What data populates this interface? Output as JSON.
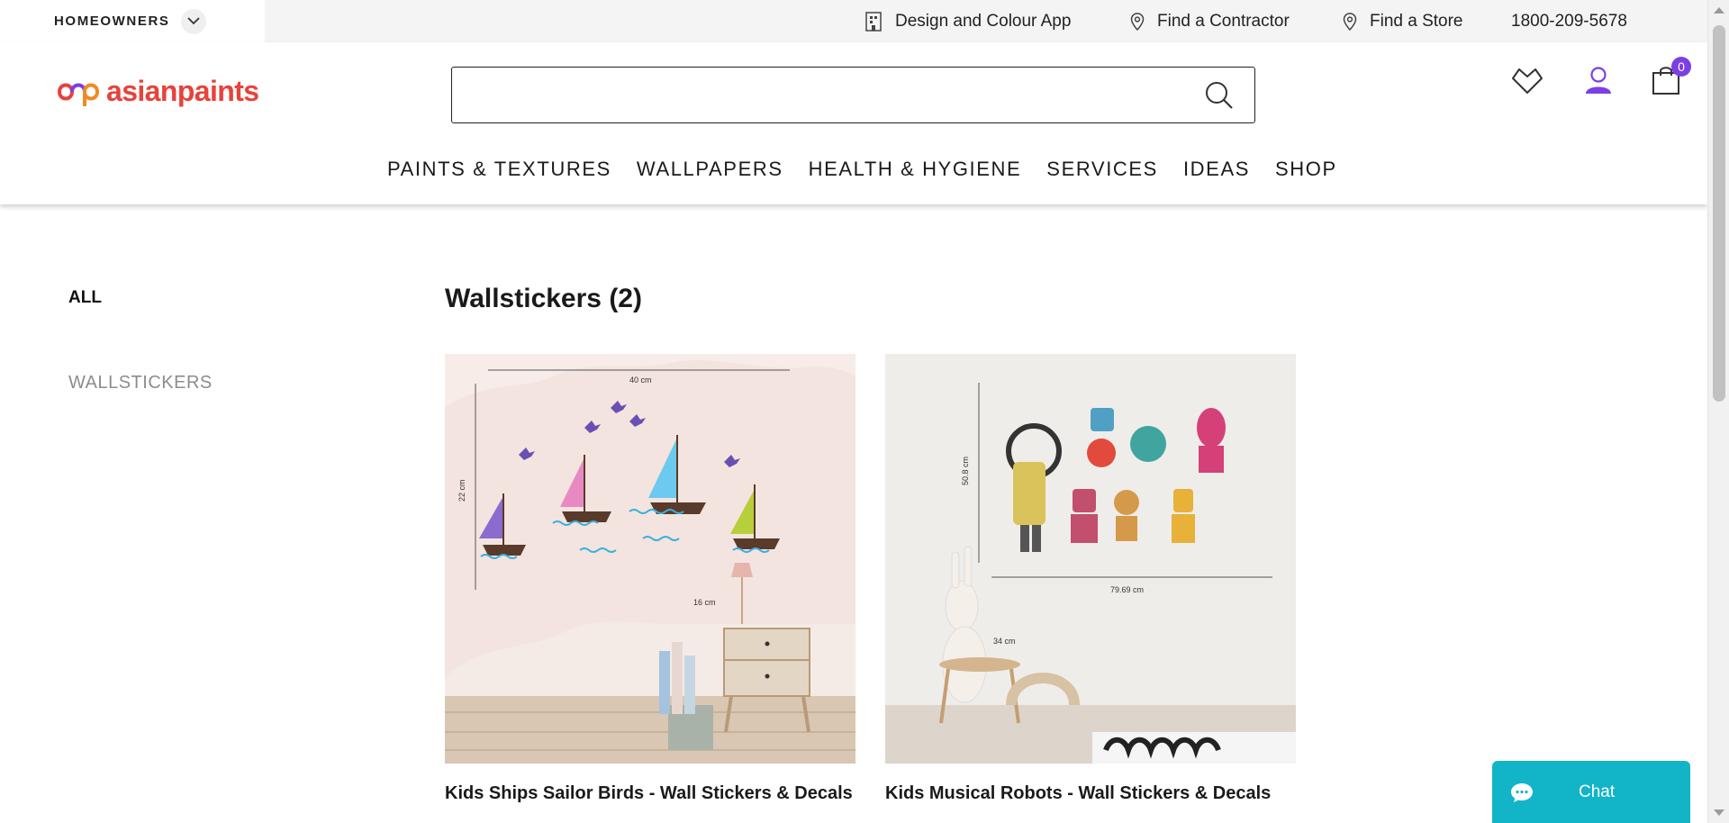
{
  "utility_bar": {
    "audience_label": "HOMEOWNERS",
    "links": [
      {
        "label": "Design and Colour App",
        "icon": "building-icon"
      },
      {
        "label": "Find a Contractor",
        "icon": "location-pin-icon"
      },
      {
        "label": "Find a Store",
        "icon": "location-pin-icon"
      },
      {
        "label": "1800-209-5678"
      }
    ]
  },
  "header": {
    "logo_text": "asianpaints",
    "search": {
      "value": "",
      "placeholder": ""
    },
    "cart_count": "0",
    "nav": [
      "PAINTS & TEXTURES",
      "WALLPAPERS",
      "HEALTH & HYGIENE",
      "SERVICES",
      "IDEAS",
      "SHOP"
    ]
  },
  "sidebar": {
    "all_label": "ALL",
    "category_label": "WALLSTICKERS"
  },
  "listing": {
    "title": "Wallstickers (2)",
    "products": [
      {
        "title": "Kids Ships Sailor Birds - Wall Stickers & Decals",
        "dimension_labels": [
          "40 cm",
          "22 cm",
          "16 cm"
        ]
      },
      {
        "title": "Kids Musical Robots - Wall Stickers & Decals",
        "dimension_labels": [
          "50.8 cm",
          "79.69 cm",
          "34 cm"
        ]
      }
    ]
  },
  "chat": {
    "label": "Chat"
  },
  "colors": {
    "brand_red": "#e8423b",
    "brand_purple": "#7b3fe4",
    "chat_teal": "#12b4c8"
  }
}
